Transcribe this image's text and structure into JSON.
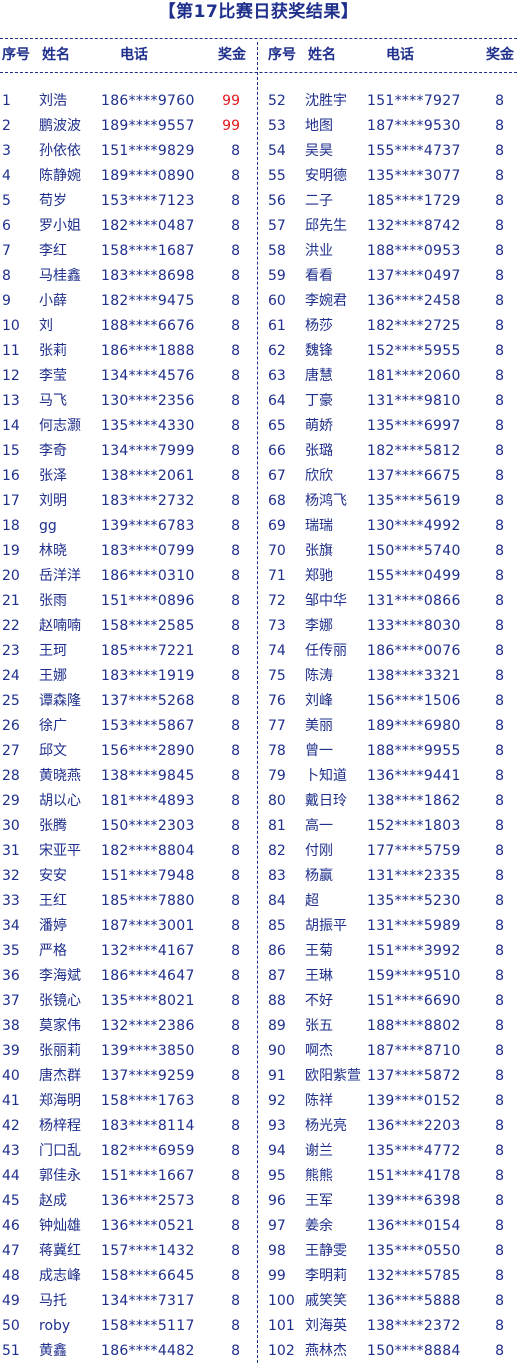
{
  "title": "【第17比赛日获奖结果】",
  "headers": {
    "no": "序号",
    "name": "姓名",
    "phone": "电话",
    "prize": "奖金"
  },
  "colors": {
    "text": "#1f2f8c",
    "highlight": "#e0181e"
  },
  "left": [
    {
      "no": "1",
      "name": "刘浩",
      "phone": "186****9760",
      "prize": "99",
      "hi": true
    },
    {
      "no": "2",
      "name": "鹏波波",
      "phone": "189****9557",
      "prize": "99",
      "hi": true
    },
    {
      "no": "3",
      "name": "孙依依",
      "phone": "151****9829",
      "prize": "8"
    },
    {
      "no": "4",
      "name": "陈静婉",
      "phone": "189****0890",
      "prize": "8"
    },
    {
      "no": "5",
      "name": "苟岁",
      "phone": "153****7123",
      "prize": "8"
    },
    {
      "no": "6",
      "name": "罗小姐",
      "phone": "182****0487",
      "prize": "8"
    },
    {
      "no": "7",
      "name": "李红",
      "phone": "158****1687",
      "prize": "8"
    },
    {
      "no": "8",
      "name": "马桂鑫",
      "phone": "183****8698",
      "prize": "8"
    },
    {
      "no": "9",
      "name": "小薛",
      "phone": "182****9475",
      "prize": "8"
    },
    {
      "no": "10",
      "name": "刘",
      "phone": "188****6676",
      "prize": "8"
    },
    {
      "no": "11",
      "name": "张莉",
      "phone": "186****1888",
      "prize": "8"
    },
    {
      "no": "12",
      "name": "李莹",
      "phone": "134****4576",
      "prize": "8"
    },
    {
      "no": "13",
      "name": "马飞",
      "phone": "130****2356",
      "prize": "8"
    },
    {
      "no": "14",
      "name": "何志灏",
      "phone": "135****4330",
      "prize": "8"
    },
    {
      "no": "15",
      "name": "李奇",
      "phone": "134****7999",
      "prize": "8"
    },
    {
      "no": "16",
      "name": "张泽",
      "phone": "138****2061",
      "prize": "8"
    },
    {
      "no": "17",
      "name": "刘明",
      "phone": "183****2732",
      "prize": "8"
    },
    {
      "no": "18",
      "name": "gg",
      "phone": "139****6783",
      "prize": "8"
    },
    {
      "no": "19",
      "name": "林晓",
      "phone": "183****0799",
      "prize": "8"
    },
    {
      "no": "20",
      "name": "岳洋洋",
      "phone": "186****0310",
      "prize": "8"
    },
    {
      "no": "21",
      "name": "张雨",
      "phone": "151****0896",
      "prize": "8"
    },
    {
      "no": "22",
      "name": "赵喃喃",
      "phone": "158****2585",
      "prize": "8"
    },
    {
      "no": "23",
      "name": "王珂",
      "phone": "185****7221",
      "prize": "8"
    },
    {
      "no": "24",
      "name": "王娜",
      "phone": "183****1919",
      "prize": "8"
    },
    {
      "no": "25",
      "name": "谭森隆",
      "phone": "137****5268",
      "prize": "8"
    },
    {
      "no": "26",
      "name": "徐广",
      "phone": "153****5867",
      "prize": "8"
    },
    {
      "no": "27",
      "name": "邱文",
      "phone": "156****2890",
      "prize": "8"
    },
    {
      "no": "28",
      "name": "黄晓燕",
      "phone": "138****9845",
      "prize": "8"
    },
    {
      "no": "29",
      "name": "胡以心",
      "phone": "181****4893",
      "prize": "8"
    },
    {
      "no": "30",
      "name": "张腾",
      "phone": "150****2303",
      "prize": "8"
    },
    {
      "no": "31",
      "name": "宋亚平",
      "phone": "182****8804",
      "prize": "8"
    },
    {
      "no": "32",
      "name": "安安",
      "phone": "151****7948",
      "prize": "8"
    },
    {
      "no": "33",
      "name": "王红",
      "phone": "185****7880",
      "prize": "8"
    },
    {
      "no": "34",
      "name": "潘婷",
      "phone": "187****3001",
      "prize": "8"
    },
    {
      "no": "35",
      "name": "严格",
      "phone": "132****4167",
      "prize": "8"
    },
    {
      "no": "36",
      "name": "李海斌",
      "phone": "186****4647",
      "prize": "8"
    },
    {
      "no": "37",
      "name": "张镜心",
      "phone": "135****8021",
      "prize": "8"
    },
    {
      "no": "38",
      "name": "莫家伟",
      "phone": "132****2386",
      "prize": "8"
    },
    {
      "no": "39",
      "name": "张丽莉",
      "phone": "139****3850",
      "prize": "8"
    },
    {
      "no": "40",
      "name": "唐杰群",
      "phone": "137****9259",
      "prize": "8"
    },
    {
      "no": "41",
      "name": "郑海明",
      "phone": "158****1763",
      "prize": "8"
    },
    {
      "no": "42",
      "name": "杨梓程",
      "phone": "183****8114",
      "prize": "8"
    },
    {
      "no": "43",
      "name": "门口乱",
      "phone": "182****6959",
      "prize": "8"
    },
    {
      "no": "44",
      "name": "郭佳永",
      "phone": "151****1667",
      "prize": "8"
    },
    {
      "no": "45",
      "name": "赵成",
      "phone": "136****2573",
      "prize": "8"
    },
    {
      "no": "46",
      "name": "钟灿雄",
      "phone": "136****0521",
      "prize": "8"
    },
    {
      "no": "47",
      "name": "蒋冀红",
      "phone": "157****1432",
      "prize": "8"
    },
    {
      "no": "48",
      "name": "成志峰",
      "phone": "158****6645",
      "prize": "8"
    },
    {
      "no": "49",
      "name": "马托",
      "phone": "134****7317",
      "prize": "8"
    },
    {
      "no": "50",
      "name": "roby",
      "phone": "158****5117",
      "prize": "8"
    },
    {
      "no": "51",
      "name": "黄鑫",
      "phone": "186****4482",
      "prize": "8"
    }
  ],
  "right": [
    {
      "no": "52",
      "name": "沈胜宇",
      "phone": "151****7927",
      "prize": "8"
    },
    {
      "no": "53",
      "name": "地图",
      "phone": "187****9530",
      "prize": "8"
    },
    {
      "no": "54",
      "name": "吴昊",
      "phone": "155****4737",
      "prize": "8"
    },
    {
      "no": "55",
      "name": "安明德",
      "phone": "135****3077",
      "prize": "8"
    },
    {
      "no": "56",
      "name": "二子",
      "phone": "185****1729",
      "prize": "8"
    },
    {
      "no": "57",
      "name": "邱先生",
      "phone": "132****8742",
      "prize": "8"
    },
    {
      "no": "58",
      "name": "洪业",
      "phone": "188****0953",
      "prize": "8"
    },
    {
      "no": "59",
      "name": "看看",
      "phone": "137****0497",
      "prize": "8"
    },
    {
      "no": "60",
      "name": "李婉君",
      "phone": "136****2458",
      "prize": "8"
    },
    {
      "no": "61",
      "name": "杨莎",
      "phone": "182****2725",
      "prize": "8"
    },
    {
      "no": "62",
      "name": "魏锋",
      "phone": "152****5955",
      "prize": "8"
    },
    {
      "no": "63",
      "name": "唐慧",
      "phone": "181****2060",
      "prize": "8"
    },
    {
      "no": "64",
      "name": "丁豪",
      "phone": "131****9810",
      "prize": "8"
    },
    {
      "no": "65",
      "name": "萌娇",
      "phone": "135****6997",
      "prize": "8"
    },
    {
      "no": "66",
      "name": "张璐",
      "phone": "182****5812",
      "prize": "8"
    },
    {
      "no": "67",
      "name": "欣欣",
      "phone": "137****6675",
      "prize": "8"
    },
    {
      "no": "68",
      "name": "杨鸿飞",
      "phone": "135****5619",
      "prize": "8"
    },
    {
      "no": "69",
      "name": "瑞瑞",
      "phone": "130****4992",
      "prize": "8"
    },
    {
      "no": "70",
      "name": "张旗",
      "phone": "150****5740",
      "prize": "8"
    },
    {
      "no": "71",
      "name": "郑驰",
      "phone": "155****0499",
      "prize": "8"
    },
    {
      "no": "72",
      "name": "邹中华",
      "phone": "131****0866",
      "prize": "8"
    },
    {
      "no": "73",
      "name": "李娜",
      "phone": "133****8030",
      "prize": "8"
    },
    {
      "no": "74",
      "name": "任传丽",
      "phone": "186****0076",
      "prize": "8"
    },
    {
      "no": "75",
      "name": "陈涛",
      "phone": "138****3321",
      "prize": "8"
    },
    {
      "no": "76",
      "name": "刘峰",
      "phone": "156****1506",
      "prize": "8"
    },
    {
      "no": "77",
      "name": "美丽",
      "phone": "189****6980",
      "prize": "8"
    },
    {
      "no": "78",
      "name": "曾一",
      "phone": "188****9955",
      "prize": "8"
    },
    {
      "no": "79",
      "name": "卜知道",
      "phone": "136****9441",
      "prize": "8"
    },
    {
      "no": "80",
      "name": "戴日玲",
      "phone": "138****1862",
      "prize": "8"
    },
    {
      "no": "81",
      "name": "高一",
      "phone": "152****1803",
      "prize": "8"
    },
    {
      "no": "82",
      "name": "付刚",
      "phone": "177****5759",
      "prize": "8"
    },
    {
      "no": "83",
      "name": "杨赢",
      "phone": "131****2335",
      "prize": "8"
    },
    {
      "no": "84",
      "name": "超",
      "phone": "135****5230",
      "prize": "8"
    },
    {
      "no": "85",
      "name": "胡振平",
      "phone": "131****5989",
      "prize": "8"
    },
    {
      "no": "86",
      "name": "王菊",
      "phone": "151****3992",
      "prize": "8"
    },
    {
      "no": "87",
      "name": "王琳",
      "phone": "159****9510",
      "prize": "8"
    },
    {
      "no": "88",
      "name": "不好",
      "phone": "151****6690",
      "prize": "8"
    },
    {
      "no": "89",
      "name": "张五",
      "phone": "188****8802",
      "prize": "8"
    },
    {
      "no": "90",
      "name": "啊杰",
      "phone": "187****8710",
      "prize": "8"
    },
    {
      "no": "91",
      "name": "欧阳紫萱",
      "phone": "137****5872",
      "prize": "8"
    },
    {
      "no": "92",
      "name": "陈祥",
      "phone": "139****0152",
      "prize": "8"
    },
    {
      "no": "93",
      "name": "杨光亮",
      "phone": "136****2203",
      "prize": "8"
    },
    {
      "no": "94",
      "name": "谢兰",
      "phone": "135****4772",
      "prize": "8"
    },
    {
      "no": "95",
      "name": "熊熊",
      "phone": "151****4178",
      "prize": "8"
    },
    {
      "no": "96",
      "name": "王军",
      "phone": "139****6398",
      "prize": "8"
    },
    {
      "no": "97",
      "name": "姜余",
      "phone": "136****0154",
      "prize": "8"
    },
    {
      "no": "98",
      "name": "王静雯",
      "phone": "135****0550",
      "prize": "8"
    },
    {
      "no": "99",
      "name": "李明莉",
      "phone": "132****5785",
      "prize": "8"
    },
    {
      "no": "100",
      "name": "戚笑笑",
      "phone": "136****5888",
      "prize": "8"
    },
    {
      "no": "101",
      "name": "刘海英",
      "phone": "138****2372",
      "prize": "8"
    },
    {
      "no": "102",
      "name": "燕林杰",
      "phone": "150****8884",
      "prize": "8"
    }
  ]
}
